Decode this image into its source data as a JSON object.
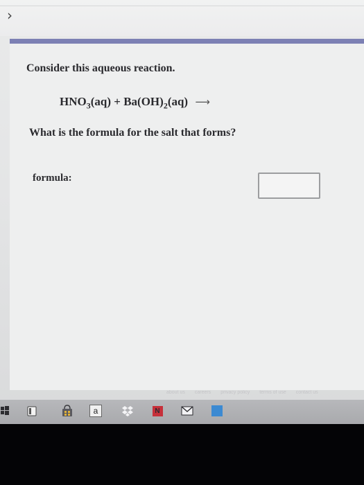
{
  "nav": {
    "forward_glyph": "›"
  },
  "question": {
    "prompt": "Consider this aqueous reaction.",
    "equation": {
      "reactant1": "HNO",
      "reactant1_sub": "3",
      "reactant1_state": "(aq)",
      "plus": "+",
      "reactant2": "Ba(OH)",
      "reactant2_sub": "2",
      "reactant2_state": "(aq)",
      "arrow": "⟶"
    },
    "ask": "What is the formula for the salt that forms?",
    "answer_label": "formula:",
    "answer_value": ""
  },
  "footer_links": [
    "about us",
    "careers",
    "privacy policy",
    "terms of use",
    "contact us"
  ],
  "taskbar": {
    "icons": [
      "windows-icon",
      "file-explorer-icon",
      "store-icon",
      "amazon-icon",
      "dropbox-icon",
      "onenote-icon",
      "mail-icon",
      "edge-icon"
    ],
    "amazon_letter": "a",
    "onenote_letter": "N"
  },
  "colors": {
    "question_bar": "#7c80b4",
    "taskbar": "#b0b1b4"
  }
}
